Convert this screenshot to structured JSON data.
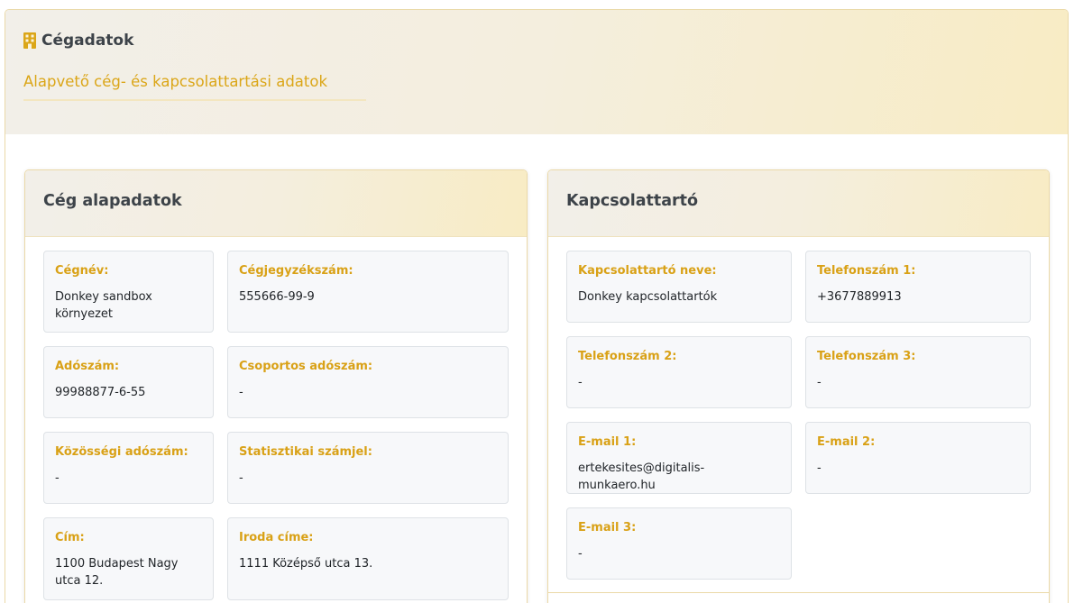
{
  "header": {
    "title": "Cégadatok",
    "subtitle": "Alapvető cég- és kapcsolattartási adatok",
    "icon": "building-icon"
  },
  "company_panel": {
    "title": "Cég alapadatok",
    "fields": [
      {
        "label": "Cégnév:",
        "value": "Donkey sandbox környezet"
      },
      {
        "label": "Cégjegyzékszám:",
        "value": "555666-99-9"
      },
      {
        "label": "Adószám:",
        "value": "99988877-6-55"
      },
      {
        "label": "Csoportos adószám:",
        "value": "-"
      },
      {
        "label": "Közösségi adószám:",
        "value": "-"
      },
      {
        "label": "Statisztikai számjel:",
        "value": "-"
      },
      {
        "label": "Cím:",
        "value": "1100 Budapest Nagy utca 12."
      },
      {
        "label": "Iroda címe:",
        "value": "1111 Középső utca 13."
      }
    ]
  },
  "contact_panel": {
    "title": "Kapcsolattartó",
    "fields": [
      {
        "label": "Kapcsolattartó neve:",
        "value": "Donkey kapcsolattartók"
      },
      {
        "label": "Telefonszám 1:",
        "value": "+3677889913"
      },
      {
        "label": "Telefonszám 2:",
        "value": "-"
      },
      {
        "label": "Telefonszám 3:",
        "value": "-"
      },
      {
        "label": "E-mail 1:",
        "value": "ertekesites@digitalis-munkaero.hu"
      },
      {
        "label": "E-mail 2:",
        "value": "-"
      },
      {
        "label": "E-mail 3:",
        "value": "-"
      }
    ]
  },
  "colors": {
    "accent": "#dba618",
    "title_text": "#3d4349",
    "field_bg": "#f7f8fa",
    "border": "#ebd9a8"
  }
}
